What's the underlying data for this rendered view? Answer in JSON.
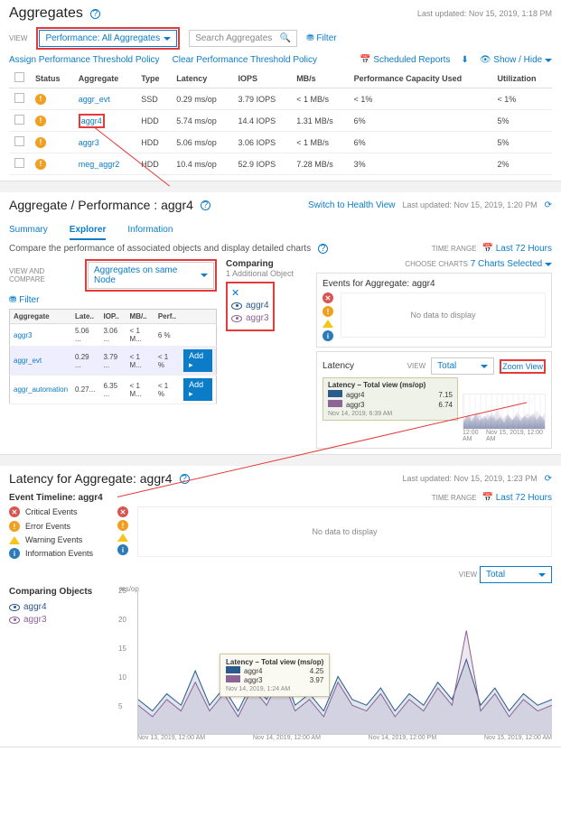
{
  "aggregates": {
    "title": "Aggregates",
    "last_updated": "Last updated: Nov 15, 2019, 1:18 PM",
    "view_label": "VIEW",
    "view_dropdown": "Performance: All Aggregates",
    "search_placeholder": "Search Aggregates",
    "filter": "Filter",
    "assign_policy": "Assign Performance Threshold Policy",
    "clear_policy": "Clear Performance Threshold Policy",
    "scheduled_reports": "Scheduled Reports",
    "show_hide": "Show / Hide",
    "columns": [
      "",
      "Status",
      "Aggregate",
      "Type",
      "Latency",
      "IOPS",
      "MB/s",
      "Performance Capacity Used",
      "Utilization"
    ],
    "rows": [
      {
        "status": "err",
        "name": "aggr_evt",
        "type": "SSD",
        "latency": "0.29 ms/op",
        "iops": "3.79 IOPS",
        "mbs": "< 1 MB/s",
        "pcu": "< 1%",
        "util": "< 1%"
      },
      {
        "status": "err",
        "name": "aggr4",
        "type": "HDD",
        "latency": "5.74 ms/op",
        "iops": "14.4 IOPS",
        "mbs": "1.31 MB/s",
        "pcu": "6%",
        "util": "5%",
        "hl": true
      },
      {
        "status": "err",
        "name": "aggr3",
        "type": "HDD",
        "latency": "5.06 ms/op",
        "iops": "3.06 IOPS",
        "mbs": "< 1 MB/s",
        "pcu": "6%",
        "util": "5%"
      },
      {
        "status": "err",
        "name": "meg_aggr2",
        "type": "HDD",
        "latency": "10.4 ms/op",
        "iops": "52.9 IOPS",
        "mbs": "7.28 MB/s",
        "pcu": "3%",
        "util": "2%"
      }
    ]
  },
  "perf": {
    "title": "Aggregate / Performance : aggr4",
    "switch_link": "Switch to Health View",
    "last_updated": "Last updated: Nov 15, 2019, 1:20 PM",
    "tabs": {
      "summary": "Summary",
      "explorer": "Explorer",
      "info": "Information"
    },
    "compare_text": "Compare the performance of associated objects and display detailed charts",
    "time_range_label": "TIME RANGE",
    "time_range_value": "Last 72 Hours",
    "view_compare_label": "VIEW AND COMPARE",
    "view_compare_dd": "Aggregates on same Node",
    "filter": "Filter",
    "mini_cols": [
      "Aggregate",
      "Late..",
      "IOP..",
      "MB/..",
      "Perf.."
    ],
    "mini_rows": [
      {
        "name": "aggr3",
        "c": [
          "5.06 ...",
          "3.06 ...",
          "< 1 M...",
          "6 %"
        ]
      },
      {
        "name": "aggr_evt",
        "c": [
          "0.29 ...",
          "3.79 ...",
          "< 1 M...",
          "< 1 %"
        ],
        "add": true
      },
      {
        "name": "aggr_automation",
        "c": [
          "0.27...",
          "6.35 ...",
          "< 1 M...",
          "< 1 %"
        ],
        "add": true
      }
    ],
    "add_label": "Add",
    "comparing_title": "Comparing",
    "comparing_sub": "1 Additional Object",
    "comparing_items": [
      {
        "name": "aggr4",
        "color": "#2b5a8c"
      },
      {
        "name": "aggr3",
        "color": "#8c6496"
      }
    ],
    "choose_charts_label": "CHOOSE CHARTS",
    "choose_charts_value": "7 Charts Selected",
    "events_title": "Events for Aggregate: aggr4",
    "no_data": "No data to display",
    "latency_title": "Latency",
    "latency_view_label": "VIEW",
    "latency_view_value": "Total",
    "zoom_view": "Zoom View",
    "legend_title": "Latency – Total view (ms/op)",
    "legend_items": [
      {
        "name": "aggr4",
        "val": "7.15",
        "color": "#2b5a8c"
      },
      {
        "name": "aggr3",
        "val": "6.74",
        "color": "#8c6496"
      }
    ],
    "legend_time": "Nov 14, 2019, 6:39 AM",
    "xaxis_left": "12:00 AM",
    "xaxis_right": "Nov 15, 2019, 12:00 AM"
  },
  "latency": {
    "title": "Latency for Aggregate: aggr4",
    "last_updated": "Last updated: Nov 15, 2019, 1:23 PM",
    "timeline_title": "Event Timeline: aggr4",
    "time_range_label": "TIME RANGE",
    "time_range_value": "Last 72 Hours",
    "ev": {
      "crit": "Critical Events",
      "err": "Error Events",
      "warn": "Warning Events",
      "info": "Information Events"
    },
    "no_data": "No data to display",
    "view_label": "VIEW",
    "view_value": "Total",
    "comparing_title": "Comparing Objects",
    "comparing": [
      {
        "name": "aggr4",
        "color": "#2b5a8c"
      },
      {
        "name": "aggr3",
        "color": "#8c6496"
      }
    ],
    "y_unit": "ms/op",
    "y_ticks": [
      25,
      20,
      15,
      10,
      5
    ],
    "tooltip_title": "Latency – Total view (ms/op)",
    "tooltip_items": [
      {
        "name": "aggr4",
        "val": "4.25",
        "color": "#2b5a8c"
      },
      {
        "name": "aggr3",
        "val": "3.97",
        "color": "#8c6496"
      }
    ],
    "tooltip_time": "Nov 14, 2019, 1:24 AM",
    "xticks": [
      "Nov 13, 2019, 12:00 AM",
      "Nov 14, 2019, 12:00 AM",
      "Nov 14, 2019, 12:00 PM",
      "Nov 15, 2019, 12:00 AM"
    ]
  },
  "chart_data": {
    "type": "line",
    "title": "Latency for Aggregate: aggr4",
    "ylabel": "ms/op",
    "ylim": [
      0,
      25
    ],
    "series": [
      {
        "name": "aggr4",
        "color": "#2b5a8c",
        "y": [
          6,
          4,
          7,
          5,
          11,
          5,
          8,
          4,
          9,
          6,
          12,
          5,
          7,
          4,
          10,
          6,
          5,
          8,
          4,
          7,
          5,
          9,
          6,
          13,
          5,
          8,
          4,
          7,
          5,
          6
        ]
      },
      {
        "name": "aggr3",
        "color": "#8c6496",
        "y": [
          5,
          3,
          6,
          4,
          9,
          4,
          7,
          3,
          8,
          5,
          10,
          4,
          6,
          3,
          9,
          5,
          4,
          7,
          3,
          6,
          4,
          8,
          5,
          18,
          4,
          7,
          3,
          6,
          4,
          5
        ]
      }
    ],
    "tooltip": {
      "time": "Nov 14, 2019, 1:24 AM",
      "aggr4": 4.25,
      "aggr3": 3.97
    }
  }
}
